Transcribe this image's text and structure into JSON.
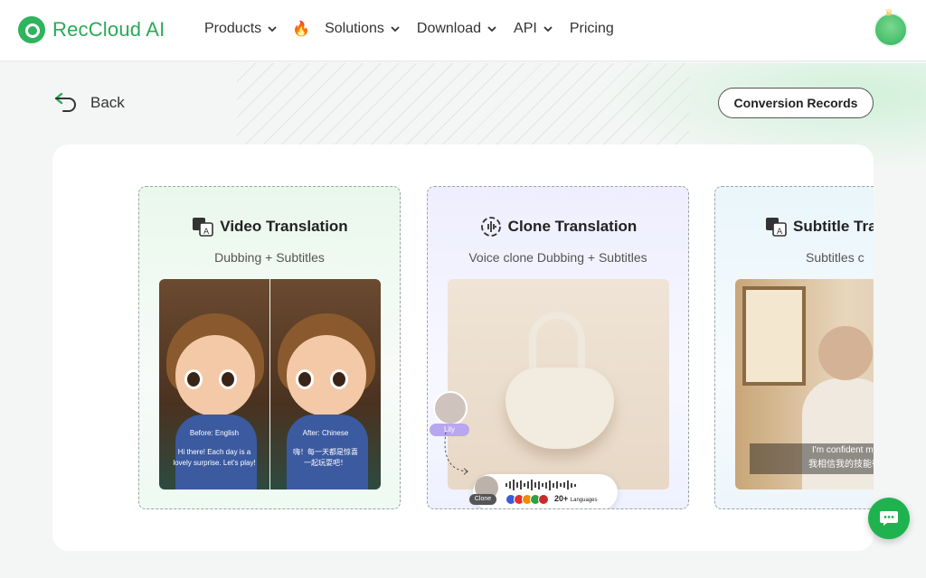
{
  "header": {
    "brand": "RecCloud AI",
    "nav": [
      {
        "label": "Products"
      },
      {
        "label": "Solutions"
      },
      {
        "label": "Download"
      },
      {
        "label": "API"
      },
      {
        "label": "Pricing"
      }
    ],
    "hot_icon": "fire-icon"
  },
  "back": {
    "label": "Back"
  },
  "records": {
    "label": "Conversion Records"
  },
  "cards": {
    "video": {
      "title": "Video Translation",
      "subtitle": "Dubbing + Subtitles",
      "before_tag": "Before: English",
      "after_tag": "After: Chinese",
      "before_caption_1": "Hi there! Each day is a",
      "before_caption_2": "lovely surprise. Let's play!",
      "after_caption_1": "嗨！每一天都是惊喜",
      "after_caption_2": "一起玩耍吧！"
    },
    "clone": {
      "title": "Clone Translation",
      "subtitle": "Voice clone Dubbing + Subtitles",
      "speaker_tag": "Lily",
      "clone_tag": "Clone",
      "languages_count": "20+",
      "languages_label": "Languages"
    },
    "subtitle": {
      "title": "Subtitle Tra",
      "subtitle": "Subtitles c",
      "caption_1": "I'm confident my skill",
      "caption_2": "我相信我的技能很适合"
    }
  },
  "colors": {
    "brand_green": "#2aa957",
    "fab_green": "#1fb34f"
  }
}
